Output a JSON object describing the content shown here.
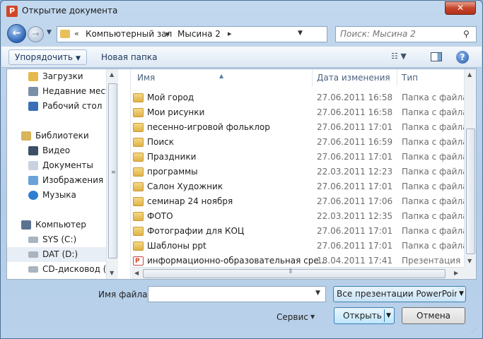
{
  "window": {
    "title": "Открытие документа",
    "app_icon_letter": "P",
    "close_glyph": "✕"
  },
  "nav": {
    "back_glyph": "←",
    "forward_glyph": "→",
    "recent_glyph": "▼",
    "address": {
      "overflow": "«",
      "segments": [
        "Компьютерный зал",
        "Мысина 2"
      ],
      "separator": "▸",
      "dropdown_glyph": "▼",
      "refresh_glyph": "⇆"
    },
    "search": {
      "placeholder": "Поиск: Мысина 2",
      "icon": "search-icon"
    }
  },
  "toolbar": {
    "organize_label": "Упорядочить",
    "new_folder_label": "Новая папка",
    "help_glyph": "?"
  },
  "sidebar": {
    "items": [
      {
        "label": "Загрузки",
        "icon": "downloads-icon",
        "color": "#e6b94c"
      },
      {
        "label": "Недавние места",
        "icon": "recent-places-icon",
        "color": "#7b8fa6"
      },
      {
        "label": "Рабочий стол",
        "icon": "desktop-icon",
        "color": "#3a6fb8"
      },
      {
        "label": "Библиотеки",
        "icon": "libraries-icon",
        "color": "#d9b45a"
      },
      {
        "label": "Видео",
        "icon": "video-icon",
        "color": "#3d4f66"
      },
      {
        "label": "Документы",
        "icon": "documents-icon",
        "color": "#c9d3df"
      },
      {
        "label": "Изображения",
        "icon": "pictures-icon",
        "color": "#6aa3d8"
      },
      {
        "label": "Музыка",
        "icon": "music-icon",
        "color": "#2f7fd0"
      },
      {
        "label": "Компьютер",
        "icon": "computer-icon",
        "color": "#5c7390"
      },
      {
        "label": "SYS (C:)",
        "icon": "drive-c-icon",
        "color": "#a8b4c0"
      },
      {
        "label": "DAT (D:)",
        "icon": "drive-d-icon",
        "color": "#a8b4c0"
      },
      {
        "label": "CD-дисковод (E:",
        "icon": "cd-drive-icon",
        "color": "#a8b4c0"
      }
    ],
    "selected_index": 10
  },
  "files": {
    "columns": {
      "name": "Имя",
      "date": "Дата изменения",
      "type": "Тип"
    },
    "rows": [
      {
        "name": "Мой город",
        "date": "27.06.2011 16:58",
        "type": "Папка с файлами",
        "icon": "folder"
      },
      {
        "name": "Мои рисунки",
        "date": "27.06.2011 16:58",
        "type": "Папка с файлами",
        "icon": "folder"
      },
      {
        "name": "песенно-игровой фольклор",
        "date": "27.06.2011 17:01",
        "type": "Папка с файлами",
        "icon": "folder"
      },
      {
        "name": "Поиск",
        "date": "27.06.2011 16:59",
        "type": "Папка с файлами",
        "icon": "folder"
      },
      {
        "name": "Праздники",
        "date": "27.06.2011 17:01",
        "type": "Папка с файлами",
        "icon": "folder"
      },
      {
        "name": "программы",
        "date": "22.03.2011 12:23",
        "type": "Папка с файлами",
        "icon": "folder"
      },
      {
        "name": "Салон Художник",
        "date": "27.06.2011 17:01",
        "type": "Папка с файлами",
        "icon": "folder"
      },
      {
        "name": "семинар 24 ноября",
        "date": "27.06.2011 17:06",
        "type": "Папка с файлами",
        "icon": "folder"
      },
      {
        "name": "ФОТО",
        "date": "22.03.2011 12:35",
        "type": "Папка с файлами",
        "icon": "folder"
      },
      {
        "name": "Фотографии для КОЦ",
        "date": "27.06.2011 17:01",
        "type": "Папка с файлами",
        "icon": "folder"
      },
      {
        "name": "Шаблоны ppt",
        "date": "27.06.2011 17:01",
        "type": "Папка с файлами",
        "icon": "folder"
      },
      {
        "name": "информационно-образовательная сре...",
        "date": "18.04.2011 17:41",
        "type": "Презентация Mic",
        "icon": "ppt"
      }
    ]
  },
  "footer": {
    "filename_label": "Имя файла:",
    "filename_value": "",
    "filter_value": "Все презентации PowerPoint (",
    "service_label": "Сервис",
    "open_label": "Открыть",
    "cancel_label": "Отмена",
    "dropdown_glyph": "▼"
  },
  "colors": {
    "frame": "#b9d1ea",
    "accent_button": "#3c7fb1",
    "close_button": "#c7452a"
  }
}
